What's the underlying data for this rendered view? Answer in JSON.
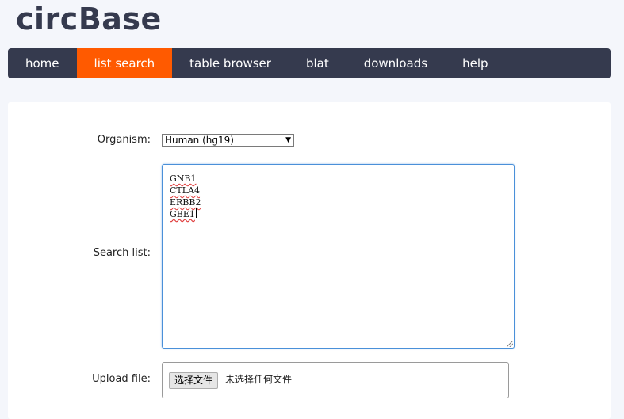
{
  "site": {
    "logo": "circBase"
  },
  "nav": {
    "items": [
      {
        "label": "home",
        "active": false
      },
      {
        "label": "list search",
        "active": true
      },
      {
        "label": "table browser",
        "active": false
      },
      {
        "label": "blat",
        "active": false
      },
      {
        "label": "downloads",
        "active": false
      },
      {
        "label": "help",
        "active": false
      }
    ]
  },
  "form": {
    "organism_label": "Organism:",
    "organism_selected": "Human (hg19)",
    "search_list_label": "Search list:",
    "search_list_lines": [
      "GNB1",
      "CTLA4",
      "ERBB2",
      "GBE1"
    ],
    "upload_label": "Upload file:",
    "upload_button": "选择文件",
    "upload_status": "未选择任何文件"
  },
  "colors": {
    "nav_bg": "#353a4e",
    "nav_active": "#ff5a00",
    "logo": "#353a4e"
  }
}
